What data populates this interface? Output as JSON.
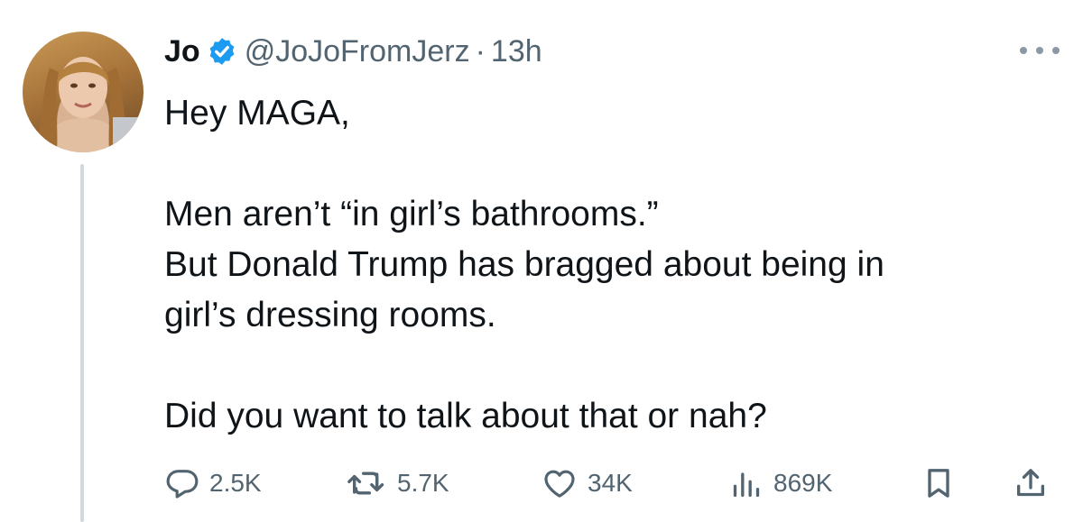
{
  "author": {
    "name": "Jo",
    "handle": "@JoJoFromJerz",
    "separator": "·",
    "time": "13h"
  },
  "tweet": {
    "line1": "Hey MAGA,",
    "line2": "Men aren’t “in girl’s bathrooms.”",
    "line3": "But Donald Trump has bragged about being in",
    "line4": "girl’s dressing rooms.",
    "line5": "Did you want to talk about that or nah?"
  },
  "stats": {
    "replies": "2.5K",
    "reposts": "5.7K",
    "likes": "34K",
    "views": "869K"
  },
  "icons": {
    "verified": "verified-badge-icon",
    "more": "more-icon",
    "reply": "reply-icon",
    "repost": "repost-icon",
    "like": "heart-icon",
    "views": "views-icon",
    "bookmark": "bookmark-icon",
    "share": "share-icon"
  },
  "colors": {
    "text": "#0f1419",
    "secondary": "#536471",
    "verified": "#1d9bf0",
    "thread_line": "#cfd9de"
  }
}
